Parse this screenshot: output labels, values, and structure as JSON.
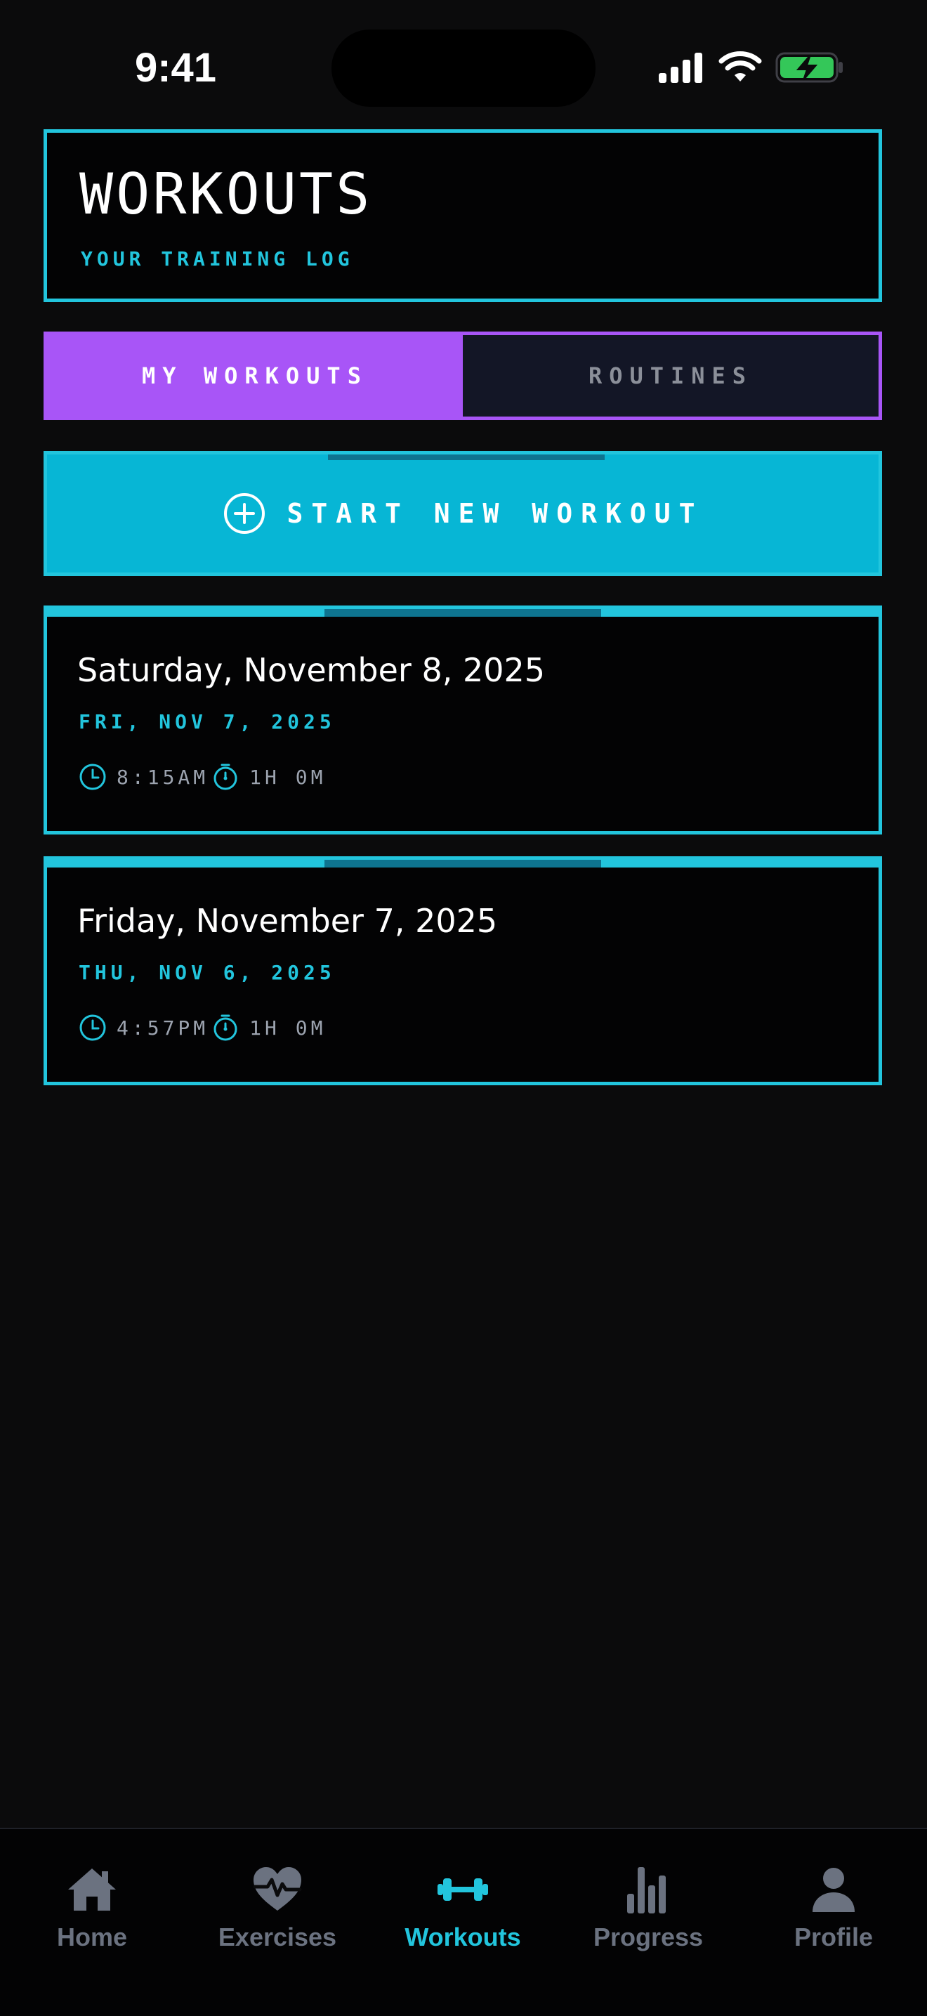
{
  "status_bar": {
    "time": "9:41"
  },
  "header": {
    "title": "WORKOUTS",
    "subtitle": "YOUR TRAINING LOG"
  },
  "tabs": [
    {
      "label": "MY WORKOUTS",
      "active": true
    },
    {
      "label": "ROUTINES",
      "active": false
    }
  ],
  "start_button": {
    "label": "START NEW WORKOUT",
    "icon": "plus-circle-icon"
  },
  "workouts": [
    {
      "title": "Saturday, November 8, 2025",
      "subdate": "FRI, NOV 7, 2025",
      "time": "8:15AM",
      "duration": "1H 0M"
    },
    {
      "title": "Friday, November 7, 2025",
      "subdate": "THU, NOV 6, 2025",
      "time": "4:57PM",
      "duration": "1H 0M"
    }
  ],
  "tab_bar": {
    "items": [
      {
        "label": "Home",
        "icon": "home-icon",
        "active": false
      },
      {
        "label": "Exercises",
        "icon": "heart-pulse-icon",
        "active": false
      },
      {
        "label": "Workouts",
        "icon": "dumbbell-icon",
        "active": true
      },
      {
        "label": "Progress",
        "icon": "bar-chart-icon",
        "active": false
      },
      {
        "label": "Profile",
        "icon": "user-icon",
        "active": false
      }
    ]
  },
  "colors": {
    "background": "#0b0b0c",
    "accent_cyan": "#22c5dd",
    "accent_purple": "#a855f7",
    "button_cyan": "#07b6d5",
    "muted_gray": "#6b7280"
  }
}
